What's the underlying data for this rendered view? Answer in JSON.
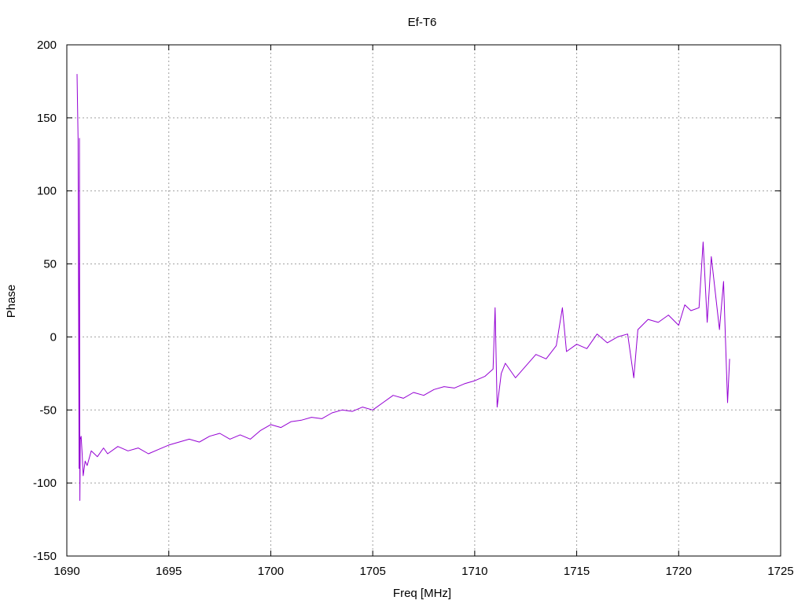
{
  "chart_data": {
    "type": "line",
    "title": "Ef-T6",
    "xlabel": "Freq [MHz]",
    "ylabel": "Phase",
    "xlim": [
      1690,
      1725
    ],
    "ylim": [
      -150,
      200
    ],
    "xticks": [
      1690,
      1695,
      1700,
      1705,
      1710,
      1715,
      1720,
      1725
    ],
    "yticks": [
      -150,
      -100,
      -50,
      0,
      50,
      100,
      150,
      200
    ],
    "grid": true,
    "legend": "none",
    "series": [
      {
        "color": "#9400d3",
        "x": [
          1690.5,
          1690.55,
          1690.6,
          1690.62,
          1690.64,
          1690.66,
          1690.7,
          1690.75,
          1690.8,
          1690.9,
          1691.0,
          1691.2,
          1691.5,
          1691.8,
          1692.0,
          1692.5,
          1693.0,
          1693.5,
          1694.0,
          1694.5,
          1695.0,
          1695.5,
          1696.0,
          1696.5,
          1697.0,
          1697.5,
          1698.0,
          1698.5,
          1699.0,
          1699.5,
          1700.0,
          1700.5,
          1701.0,
          1701.5,
          1702.0,
          1702.5,
          1703.0,
          1703.5,
          1704.0,
          1704.5,
          1705.0,
          1705.5,
          1706.0,
          1706.5,
          1707.0,
          1707.5,
          1708.0,
          1708.5,
          1709.0,
          1709.5,
          1710.0,
          1710.5,
          1710.9,
          1711.0,
          1711.1,
          1711.3,
          1711.5,
          1712.0,
          1712.5,
          1713.0,
          1713.5,
          1714.0,
          1714.3,
          1714.5,
          1715.0,
          1715.5,
          1716.0,
          1716.5,
          1717.0,
          1717.5,
          1717.8,
          1718.0,
          1718.5,
          1719.0,
          1719.5,
          1720.0,
          1720.3,
          1720.6,
          1721.0,
          1721.2,
          1721.4,
          1721.6,
          1721.8,
          1722.0,
          1722.2,
          1722.4,
          1722.5
        ],
        "y": [
          180,
          136,
          -90,
          136,
          -112,
          -70,
          -68,
          -80,
          -95,
          -85,
          -88,
          -78,
          -82,
          -76,
          -80,
          -75,
          -78,
          -76,
          -80,
          -77,
          -74,
          -72,
          -70,
          -72,
          -68,
          -66,
          -70,
          -67,
          -70,
          -64,
          -60,
          -62,
          -58,
          -57,
          -55,
          -56,
          -52,
          -50,
          -51,
          -48,
          -50,
          -45,
          -40,
          -42,
          -38,
          -40,
          -36,
          -34,
          -35,
          -32,
          -30,
          -27,
          -22,
          20,
          -48,
          -25,
          -18,
          -28,
          -20,
          -12,
          -15,
          -6,
          20,
          -10,
          -5,
          -8,
          2,
          -4,
          0,
          2,
          -28,
          5,
          12,
          10,
          15,
          8,
          22,
          18,
          20,
          65,
          10,
          55,
          30,
          5,
          38,
          -45,
          -15
        ]
      }
    ]
  }
}
